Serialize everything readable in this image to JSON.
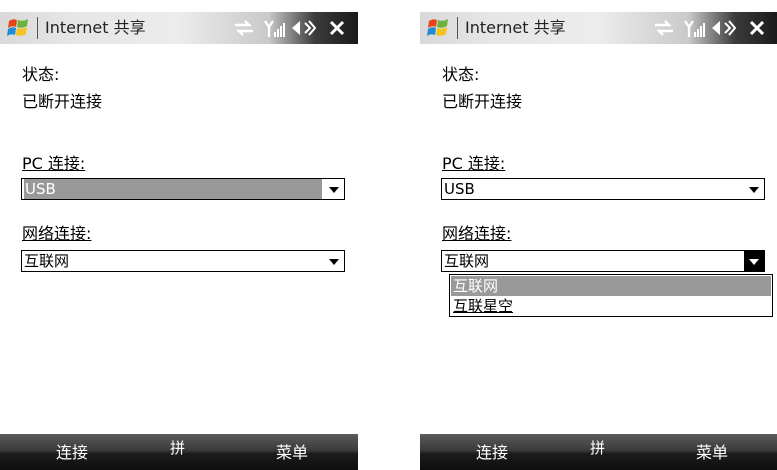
{
  "title_bar": {
    "title": "Internet 共享"
  },
  "screens": [
    {
      "status_label": "状态:",
      "status_value": "已断开连接",
      "pc_connection_label": "PC 连接:",
      "pc_connection_value": "USB",
      "network_connection_label": "网络连接:",
      "network_connection_value": "互联网"
    },
    {
      "status_label": "状态:",
      "status_value": "已断开连接",
      "pc_connection_label": "PC 连接:",
      "pc_connection_value": "USB",
      "network_connection_label": "网络连接:",
      "network_connection_value": "互联网",
      "network_options": [
        "互联网",
        "互联星空"
      ],
      "network_selected_option": "互联网"
    }
  ],
  "softkeys": {
    "left": "连接",
    "input_method": "拼",
    "right": "菜单"
  },
  "colors": {
    "selection": "#999999",
    "softkey_bar": "#1c1c1c",
    "title_bar": "#e6e6e6"
  },
  "icons": [
    "windows-start-icon",
    "sync-icon",
    "signal-icon",
    "volume-icon",
    "close-icon",
    "dropdown-arrow-icon"
  ]
}
